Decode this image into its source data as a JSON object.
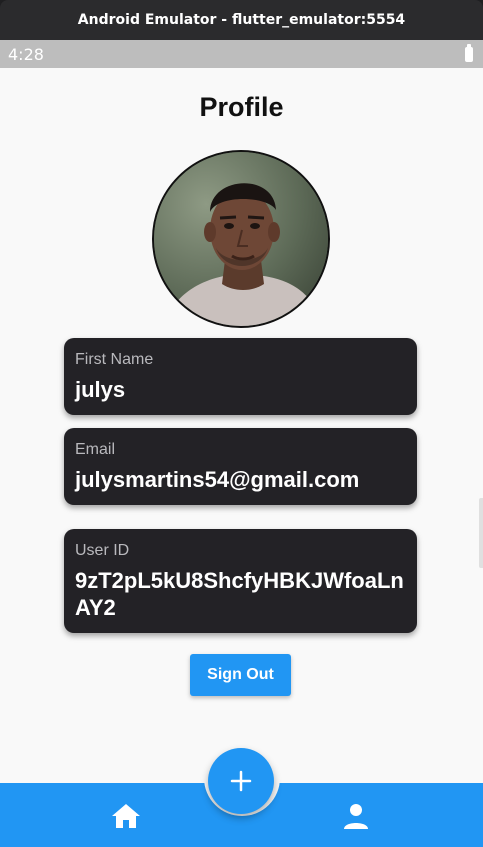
{
  "window": {
    "title": "Android Emulator - flutter_emulator:5554"
  },
  "status_bar": {
    "time": "4:28",
    "battery_icon": "battery-icon"
  },
  "page": {
    "title": "Profile"
  },
  "profile": {
    "avatar": "profile-photo",
    "fields": [
      {
        "label": "First Name",
        "value": "julys"
      },
      {
        "label": "Email",
        "value": "julysmartins54@gmail.com"
      },
      {
        "label": "User ID",
        "value": "9zT2pL5kU8ShcfyHBKJWfoaLnAY2"
      }
    ]
  },
  "actions": {
    "sign_out_label": "Sign Out"
  },
  "bottom_nav": {
    "fab_icon": "plus-icon",
    "items": [
      {
        "icon": "home-icon"
      },
      {
        "icon": "person-icon"
      }
    ]
  },
  "colors": {
    "accent": "#2196f3",
    "card_background": "#232226",
    "screen_background": "#f9f9f9"
  }
}
